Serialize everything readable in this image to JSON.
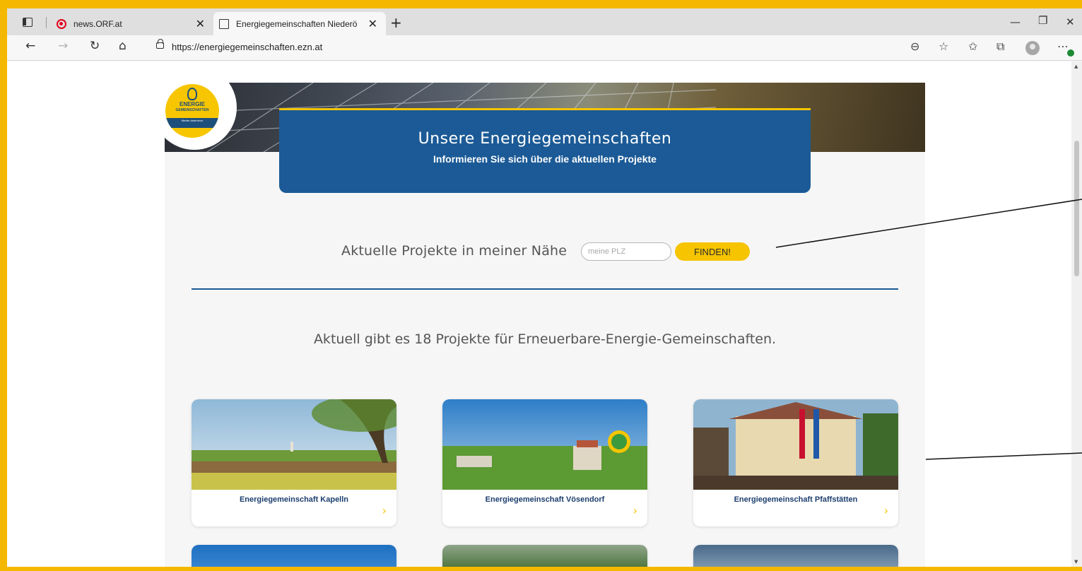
{
  "browser": {
    "tabs": [
      {
        "label": "news.ORF.at",
        "icon": "orf-icon"
      },
      {
        "label": "Energiegemeinschaften Niederösterreich",
        "icon": "page-icon"
      }
    ],
    "url": "https://energiegemeinschaften.ezn.at"
  },
  "logo": {
    "line1": "ENERGIE",
    "line2": "GEMEINSCHAFTEN",
    "band": "Nieder-österreich"
  },
  "banner": {
    "title": "Unsere Energiegemeinschaften",
    "subtitle": "Informieren Sie sich über die aktuellen Projekte"
  },
  "search": {
    "label": "Aktuelle Projekte in meiner Nähe",
    "placeholder": "meine PLZ",
    "button": "FINDEN!"
  },
  "summary": "Aktuell gibt es 18 Projekte für Erneuerbare-Energie-Gemeinschaften.",
  "projects": [
    {
      "title": "Energiegemeinschaft Kapelln",
      "arrow": "›"
    },
    {
      "title": "Energiegemeinschaft Vösendorf",
      "arrow": "›"
    },
    {
      "title": "Energiegemeinschaft Pfaffstätten",
      "arrow": "›"
    }
  ]
}
